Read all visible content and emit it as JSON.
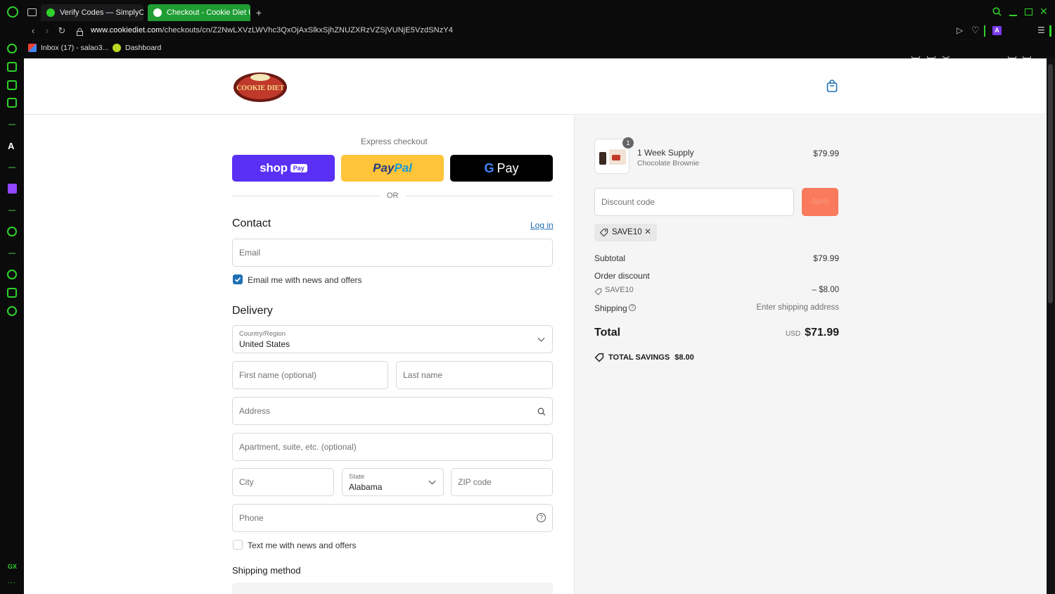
{
  "browser": {
    "tabs": [
      {
        "label": "Verify Codes — SimplyCo"
      },
      {
        "label": "Checkout - Cookie Diet U"
      }
    ],
    "url_host": "www.cookiediet.com",
    "url_path": "/checkouts/cn/Z2NwLXVzLWVhc3QxOjAxSlkxSjhZNUZXRzVZSjVUNjE5VzdSNzY4",
    "bookmarks": [
      {
        "label": "Inbox (17) - salao3..."
      },
      {
        "label": "Dashboard"
      }
    ],
    "sidebar_bottom_label": "GX",
    "sidebar_more": "···"
  },
  "header": {
    "logo_text": "COOKIE DIET"
  },
  "checkout": {
    "express_label": "Express checkout",
    "shop_pay": {
      "word": "shop",
      "badge": "Pay"
    },
    "paypal": {
      "pay": "Pay",
      "pal": "Pal"
    },
    "gpay": {
      "g": "G",
      "pay": "Pay"
    },
    "or_label": "OR",
    "contact": {
      "heading": "Contact",
      "login_link": "Log in",
      "email_placeholder": "Email",
      "news_checkbox_label": "Email me with news and offers",
      "news_checked": true
    },
    "delivery": {
      "heading": "Delivery",
      "country_label": "Country/Region",
      "country_value": "United States",
      "first_name_placeholder": "First name (optional)",
      "last_name_placeholder": "Last name",
      "address_placeholder": "Address",
      "apartment_placeholder": "Apartment, suite, etc. (optional)",
      "city_placeholder": "City",
      "state_label": "State",
      "state_value": "Alabama",
      "zip_placeholder": "ZIP code",
      "phone_placeholder": "Phone",
      "sms_checkbox_label": "Text me with news and offers",
      "sms_checked": false
    },
    "shipping_method_heading": "Shipping method"
  },
  "summary": {
    "item": {
      "qty": "1",
      "name": "1 Week Supply",
      "variant": "Chocolate Brownie",
      "price": "$79.99"
    },
    "discount_placeholder": "Discount code",
    "apply_label": "Apply",
    "applied_code": "SAVE10",
    "subtotal_label": "Subtotal",
    "subtotal_value": "$79.99",
    "order_discount_label": "Order discount",
    "order_discount_code": "SAVE10",
    "order_discount_value": "– $8.00",
    "shipping_label": "Shipping",
    "shipping_value": "Enter shipping address",
    "total_label": "Total",
    "currency": "USD",
    "total_value": "$71.99",
    "savings_label": "TOTAL SAVINGS",
    "savings_value": "$8.00"
  },
  "colors": {
    "accent": "#1f6fb5",
    "shop_pay": "#5a31f4",
    "paypal": "#ffc439",
    "apply_button": "#f97a5c",
    "browser_accent": "#2fd12b"
  }
}
